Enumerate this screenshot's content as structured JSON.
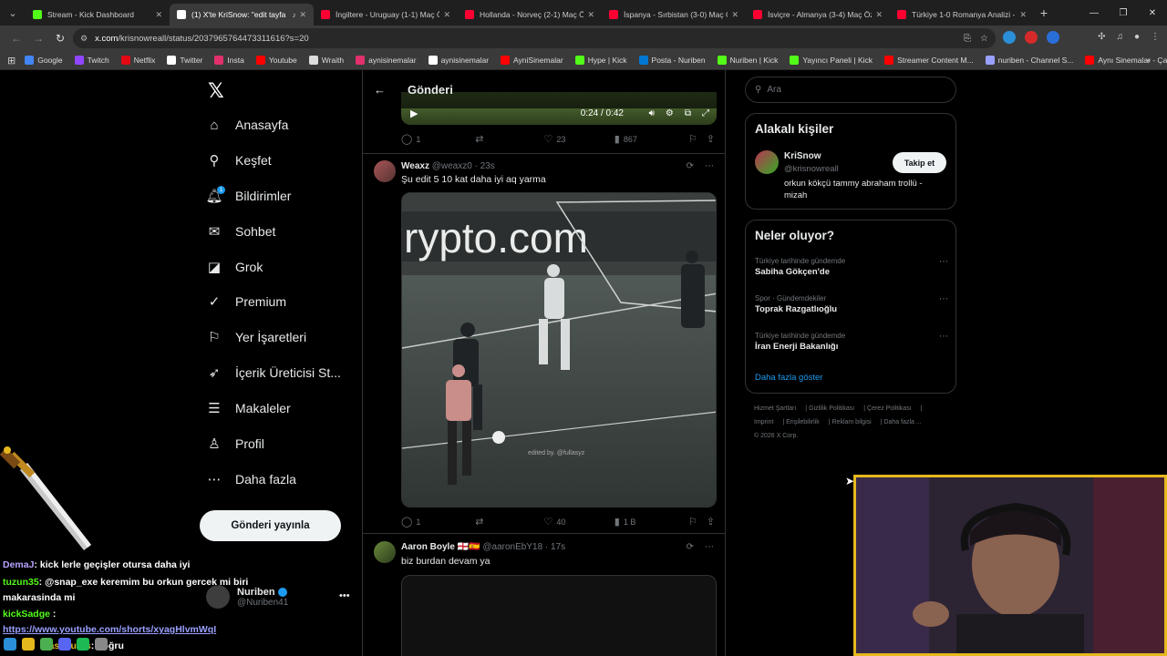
{
  "browser": {
    "tabs": [
      {
        "title": "Stream - Kick Dashboard",
        "fav": "#53fc18",
        "active": false
      },
      {
        "title": "(1) X'te KriSnow: \"edit tayfa",
        "fav": "#ffffff",
        "active": true
      },
      {
        "title": "İngiltere - Uruguay (1-1) Maç Ö",
        "fav": "#ff0033",
        "active": false
      },
      {
        "title": "Hollanda - Norveç (2-1) Maç Öz",
        "fav": "#ff0033",
        "active": false
      },
      {
        "title": "İspanya - Sırbistan (3-0) Maç Ö",
        "fav": "#ff0033",
        "active": false
      },
      {
        "title": "İsviçre - Almanya (3-4) Maç Öz",
        "fav": "#ff0033",
        "active": false
      },
      {
        "title": "Türkiye 1-0 Romanya Analizi -",
        "fav": "#ff0033",
        "active": false
      }
    ],
    "url_host": "x.com",
    "url_path": "/krisnowreall/status/2037965764473311616?s=20",
    "bookmarks": [
      {
        "label": "Google",
        "color": "#4285f4"
      },
      {
        "label": "Twitch",
        "color": "#9146ff"
      },
      {
        "label": "Netflix",
        "color": "#e50914"
      },
      {
        "label": "Twitter",
        "color": "#ffffff"
      },
      {
        "label": "Insta",
        "color": "#e1306c"
      },
      {
        "label": "Youtube",
        "color": "#ff0000"
      },
      {
        "label": "Wraith",
        "color": "#dddddd"
      },
      {
        "label": "aynisinemalar",
        "color": "#e1306c"
      },
      {
        "label": "aynisinemalar",
        "color": "#ffffff"
      },
      {
        "label": "AyniSinemalar",
        "color": "#ff0000"
      },
      {
        "label": "Hype | Kick",
        "color": "#53fc18"
      },
      {
        "label": "Posta - Nuriben",
        "color": "#0078d4"
      },
      {
        "label": "Nuriben | Kick",
        "color": "#53fc18"
      },
      {
        "label": "Yayıncı Paneli | Kick",
        "color": "#53fc18"
      },
      {
        "label": "Streamer Content M...",
        "color": "#ff0000"
      },
      {
        "label": "nuriben - Channel S...",
        "color": "#9aa0ff"
      },
      {
        "label": "Aynı Sinemalar - Ça...",
        "color": "#ff0000"
      }
    ]
  },
  "nav": {
    "items": [
      {
        "label": "Anasayfa",
        "icon": "home-icon",
        "glyph": "⌂"
      },
      {
        "label": "Keşfet",
        "icon": "search-icon",
        "glyph": "⚲"
      },
      {
        "label": "Bildirimler",
        "icon": "bell-icon",
        "glyph": "🔔︎",
        "badge": "1"
      },
      {
        "label": "Sohbet",
        "icon": "mail-icon",
        "glyph": "✉"
      },
      {
        "label": "Grok",
        "icon": "grok-icon",
        "glyph": "◪"
      },
      {
        "label": "Premium",
        "icon": "premium-icon",
        "glyph": "✓"
      },
      {
        "label": "Yer İşaretleri",
        "icon": "bookmark-icon",
        "glyph": "⚐"
      },
      {
        "label": "İçerik Üreticisi St...",
        "icon": "rocket-icon",
        "glyph": "➶"
      },
      {
        "label": "Makaleler",
        "icon": "articles-icon",
        "glyph": "☰"
      },
      {
        "label": "Profil",
        "icon": "profile-icon",
        "glyph": "♙"
      },
      {
        "label": "Daha fazla",
        "icon": "more-icon",
        "glyph": "⋯"
      }
    ],
    "post_button": "Gönderi yayınla",
    "account": {
      "name": "Nuriben",
      "handle": "@Nuriben41"
    }
  },
  "timeline": {
    "header": "Gönderi",
    "top_video": {
      "time": "0:24 / 0:42"
    },
    "top_actions": {
      "replies": "1",
      "reposts": "",
      "likes": "23",
      "views": "867"
    },
    "posts": [
      {
        "name": "Weaxz",
        "handle": "@weaxz0 · 23s",
        "text": "Şu edit 5 10 kat daha iyi aq yarma",
        "media_caption": "rypto.com",
        "watermark": "edited by. @fullasyz",
        "actions": {
          "replies": "1",
          "reposts": "",
          "likes": "40",
          "views": "1 B"
        }
      },
      {
        "name": "Aaron Boyle 🏴󠁧󠁢󠁥󠁮󠁧󠁿🇪🇸",
        "handle": "@aaronEbY18 · 17s",
        "text": "biz burdan devam ya"
      }
    ]
  },
  "sidebar": {
    "search_placeholder": "Ara",
    "related_title": "Alakalı kişiler",
    "person": {
      "name": "KriSnow",
      "handle": "@krisnowreall",
      "bio": "orkun kökçü tammy abraham trollü - mizah",
      "follow_label": "Takip et"
    },
    "trends_title": "Neler oluyor?",
    "trends": [
      {
        "context": "Türkiye tarihinde gündemde",
        "topic": "Sabiha Gökçen'de"
      },
      {
        "context": "Spor · Gündemdekiler",
        "topic": "Toprak Razgatlıoğlu"
      },
      {
        "context": "Türkiye tarihinde gündemde",
        "topic": "İran Enerji Bakanlığı"
      }
    ],
    "show_more": "Daha fazla göster",
    "footer": [
      "Hizmet Şartları",
      "Gizlilik Politikası",
      "Çerez Politikası",
      "Imprint",
      "Erişilebilirlik",
      "Reklam bilgisi",
      "Daha fazla ...",
      "© 2026 X Corp."
    ]
  },
  "overlay": {
    "chat": [
      {
        "user": "DemaJ",
        "user_color": "#b9a2ff",
        "text": ": kick lerle geçişler otursa daha iyi"
      },
      {
        "user": "tuzun35",
        "user_color": "#53fc18",
        "text": ": @snap_exe keremim bu orkun gercek mi biri"
      },
      {
        "user": "",
        "user_color": "#ffffff",
        "text": "makarasinda mi"
      },
      {
        "user": "kickSadge",
        "user_color": "#53fc18",
        "text": " :"
      },
      {
        "user": "",
        "user_color": "#9aa0ff",
        "text": "https://www.youtube.com/shorts/xyagHlvmWqI"
      },
      {
        "user": "Basehurss",
        "user_color": "#e5b81d",
        "text": ": doğru"
      }
    ]
  }
}
